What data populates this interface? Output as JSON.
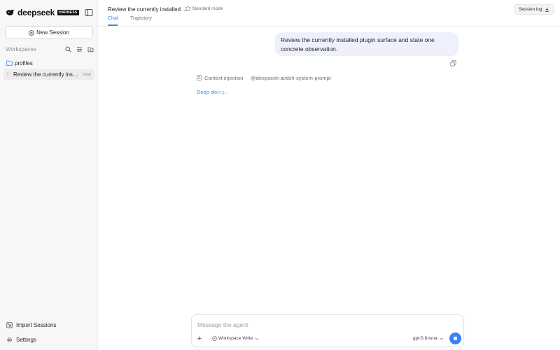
{
  "brand": {
    "name": "deepseek",
    "badge": "HARNESS"
  },
  "sidebar": {
    "new_session_label": "New Session",
    "workspaces_label": "Workspaces",
    "folder": {
      "name": "profiles"
    },
    "session": {
      "title": "Review the currently installed plugin surface and state one concrete observation.",
      "time": "now"
    },
    "import_label": "Import Sessions",
    "settings_label": "Settings"
  },
  "header": {
    "title": "Review the currently installed ...",
    "mode": "Standard mode",
    "tabs": [
      {
        "label": "Chat",
        "active": true
      },
      {
        "label": "Trajectory",
        "active": false
      }
    ],
    "session_log_label": "Session log"
  },
  "chat": {
    "user_message": "Review the currently installed plugin surface and state one concrete observation.",
    "context_label": "Context injection",
    "context_source": "@deepseek-ai/dsh-system-prompt",
    "status_bright": "Deep div",
    "status_faded": "ing..."
  },
  "composer": {
    "placeholder": "Message the agent",
    "permission_label": "Workspace Write",
    "model_label": "gpt-5.6-luna"
  },
  "colors": {
    "accent": "#3b82f6",
    "sidebar_bg": "#f7f7f8",
    "bubble_bg": "#eef1fb"
  }
}
